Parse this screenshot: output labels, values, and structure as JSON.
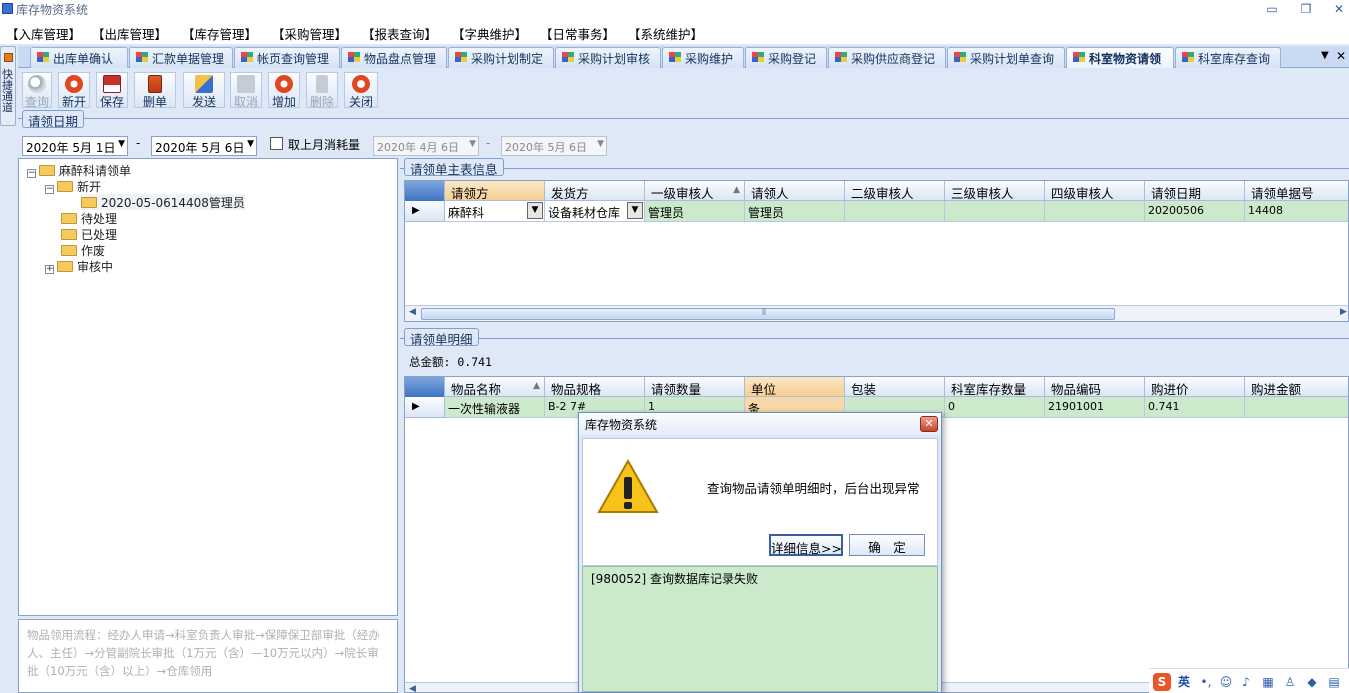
{
  "app": {
    "title": "库存物资系统"
  },
  "window_controls": {
    "minimize": "▭",
    "restore": "❐",
    "close": "✕"
  },
  "menu": [
    "【入库管理】",
    "【出库管理】",
    "【库存管理】",
    "【采购管理】",
    "【报表查询】",
    "【字典维护】",
    "【日常事务】",
    "【系统维护】"
  ],
  "tabs": [
    "出库单确认",
    "汇款单据管理",
    "帐页查询管理",
    "物品盘点管理",
    "采购计划制定",
    "采购计划审核",
    "采购维护",
    "采购登记",
    "采购供应商登记",
    "采购计划单查询",
    "科室物资请领",
    "科室库存查询"
  ],
  "active_tab": "科室物资请领",
  "tab_overflow_icon": "▼",
  "tab_close_icon": "✕",
  "quick_channel": "快捷通道",
  "toolbar": [
    {
      "label": "查询",
      "icon": "search-icon",
      "disabled": true
    },
    {
      "label": "新开",
      "icon": "new-icon",
      "disabled": false
    },
    {
      "label": "保存",
      "icon": "save-icon",
      "disabled": false
    },
    {
      "label": "删单",
      "icon": "delete-icon",
      "disabled": false
    },
    {
      "label": "发送",
      "icon": "send-icon",
      "disabled": false
    },
    {
      "label": "取消",
      "icon": "cancel-icon",
      "disabled": true
    },
    {
      "label": "增加",
      "icon": "add-icon",
      "disabled": false
    },
    {
      "label": "删除",
      "icon": "remove-icon",
      "disabled": true
    },
    {
      "label": "关闭",
      "icon": "power-icon",
      "disabled": false
    }
  ],
  "date_group": {
    "label": "请领日期",
    "from": "2020年 5月 1日",
    "to": "2020年 5月 6日",
    "separator": "-",
    "checkbox_label": "取上月消耗量",
    "prev_from": "2020年 4月 6日",
    "prev_to": "2020年 5月 6日"
  },
  "tree": {
    "root": "麻醉科请领单",
    "new_node": "新开",
    "new_child": "2020-05-0614408管理员",
    "pending": "待处理",
    "processed": "已处理",
    "void": "作废",
    "reviewing": "审核中",
    "expand_minus": "−",
    "expand_plus": "+"
  },
  "flow_text": "物品领用流程：经办人申请→科室负责人审批→保障保卫部审批（经办人、主任）→分管副院长审批（1万元（含）—10万元以内）→院长审批（10万元（含）以上）→仓库领用",
  "master": {
    "label": "请领单主表信息",
    "columns": [
      "请领方",
      "发货方",
      "一级审核人",
      "请领人",
      "二级审核人",
      "三级审核人",
      "四级审核人",
      "请领日期",
      "请领单据号"
    ],
    "row": {
      "dept": "麻醉科",
      "supplier": "设备耗材仓库",
      "level1": "管理员",
      "applicant": "管理员",
      "level2": "",
      "level3": "",
      "level4": "",
      "date": "20200506",
      "doc_no": "14408"
    }
  },
  "detail": {
    "label": "请领单明细",
    "total_label": "总金额: 0.741",
    "columns": [
      "物品名称",
      "物品规格",
      "请领数量",
      "单位",
      "包装",
      "科室库存数量",
      "物品编码",
      "购进价",
      "购进金额"
    ],
    "row": {
      "name": "一次性输液器",
      "spec": "B-2 7#",
      "qty": "1",
      "unit": "条",
      "package": "",
      "stock": "0",
      "code": "21901001",
      "price": "0.741",
      "amount": ""
    }
  },
  "dialog": {
    "title": "库存物资系统",
    "message": "查询物品请领单明细时，后台出现异常",
    "details_button": "详细信息>>",
    "ok_button": "确　定",
    "detail_text": "[980052] 查询数据库记录失败",
    "warning_mark": "!"
  },
  "ime": {
    "label": "英",
    "logo": "S"
  },
  "row_marker": "▶",
  "scroll_left": "◀",
  "scroll_right": "▶",
  "scroll_grip": "⦀",
  "dropdown_arrow": "▼",
  "sort_arrow": "▲"
}
